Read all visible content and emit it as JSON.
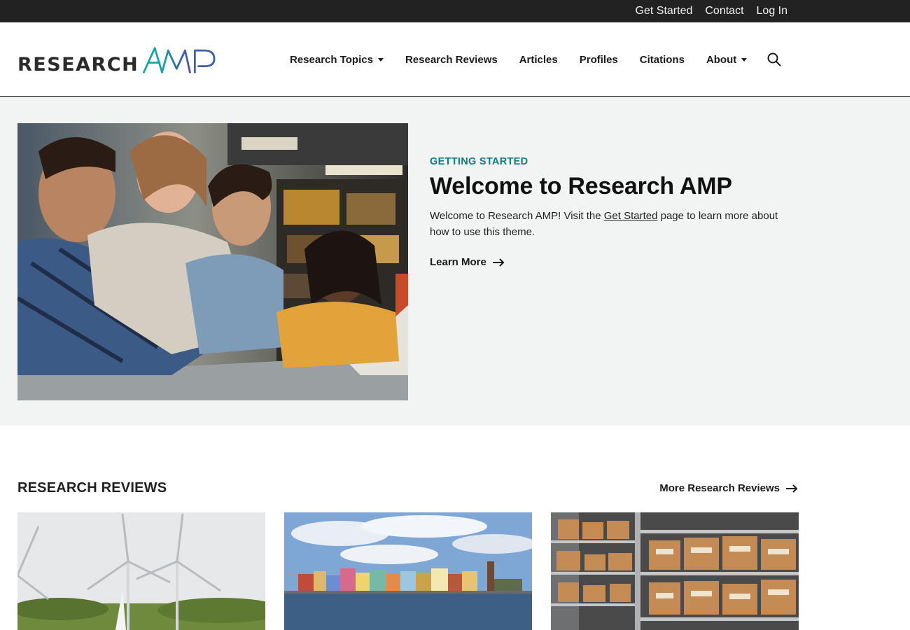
{
  "utility_nav": [
    "Get Started",
    "Contact",
    "Log In"
  ],
  "logo": {
    "text": "RESEARCH",
    "mark": "AMP"
  },
  "nav": {
    "items": [
      {
        "label": "Research Topics",
        "dropdown": true
      },
      {
        "label": "Research Reviews",
        "dropdown": false
      },
      {
        "label": "Articles",
        "dropdown": false
      },
      {
        "label": "Profiles",
        "dropdown": false
      },
      {
        "label": "Citations",
        "dropdown": false
      },
      {
        "label": "About",
        "dropdown": true
      }
    ],
    "search_icon": "search-icon"
  },
  "hero": {
    "eyebrow": "GETTING STARTED",
    "title": "Welcome to Research AMP",
    "desc_before": "Welcome to Research AMP! Visit the ",
    "desc_link": "Get Started",
    "desc_after": " page to learn more about how to use this theme.",
    "cta": "Learn More"
  },
  "reviews": {
    "title": "RESEARCH REVIEWS",
    "more": "More Research Reviews",
    "cards": [
      "wind-turbines-image",
      "waterfront-town-image",
      "archive-shelves-image"
    ]
  },
  "colors": {
    "accent": "#0e7c80",
    "topbar": "#222222",
    "hero_bg": "#f2f3f3"
  }
}
